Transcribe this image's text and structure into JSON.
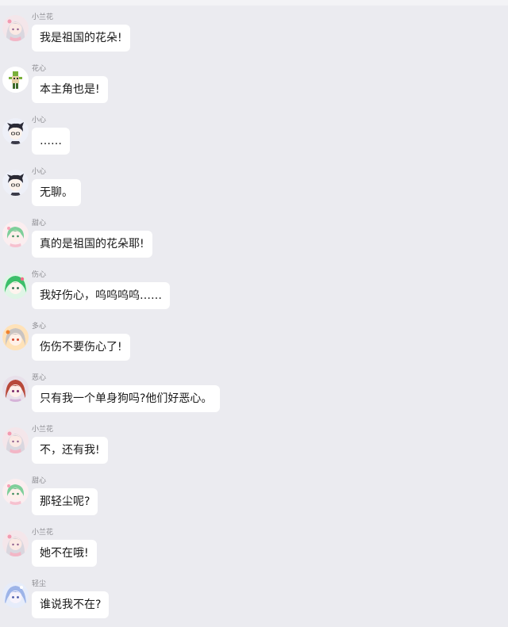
{
  "messages": [
    {
      "name": "小兰花",
      "text": "我是祖国的花朵!",
      "avatar": "lanhua-avatar"
    },
    {
      "name": "花心",
      "text": "本主角也是!",
      "avatar": "huaxin-avatar"
    },
    {
      "name": "小心",
      "text": "……",
      "avatar": "xiaoxin-avatar"
    },
    {
      "name": "小心",
      "text": "无聊。",
      "avatar": "xiaoxin-avatar"
    },
    {
      "name": "甜心",
      "text": "真的是祖国的花朵耶!",
      "avatar": "tianxin-avatar"
    },
    {
      "name": "伤心",
      "text": "我好伤心，呜呜呜呜……",
      "avatar": "shangxin-avatar"
    },
    {
      "name": "多心",
      "text": "伤伤不要伤心了!",
      "avatar": "duoxin-avatar"
    },
    {
      "name": "恶心",
      "text": "只有我一个单身狗吗?他们好恶心。",
      "avatar": "exin-avatar"
    },
    {
      "name": "小兰花",
      "text": "不，还有我!",
      "avatar": "lanhua-avatar"
    },
    {
      "name": "甜心",
      "text": "那轻尘呢?",
      "avatar": "tianxin-avatar"
    },
    {
      "name": "小兰花",
      "text": "她不在哦!",
      "avatar": "lanhua-avatar"
    },
    {
      "name": "轻尘",
      "text": "谁说我不在?",
      "avatar": "qingchen-avatar"
    }
  ],
  "colors": {
    "background": "#ebebf0",
    "bubble": "#ffffff",
    "name_text": "#8a8a8f",
    "message_text": "#1a1a1a"
  }
}
